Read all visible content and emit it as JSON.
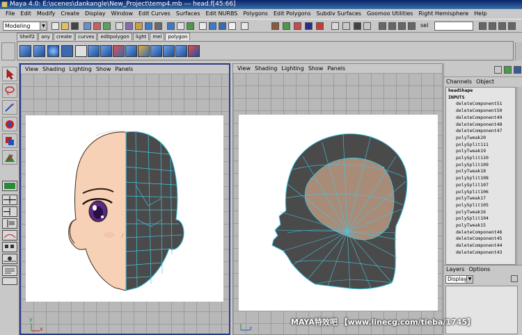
{
  "window": {
    "title": "Maya 4.0: E:\\scenes\\dankangle\\New_Project\\temp4.mb   ---   head.f[45:66]"
  },
  "menubar": [
    "File",
    "Edit",
    "Modify",
    "Create",
    "Display",
    "Window",
    "Edit Curves",
    "Surfaces",
    "Edit NURBS",
    "Polygons",
    "Edit Polygons",
    "Subdiv Surfaces",
    "Goomoo Utilities",
    "Right Hemisphere",
    "Help"
  ],
  "statusline": {
    "mode": "Modeling",
    "sel_label": "sel"
  },
  "shelf_tabs": [
    "Shelf2",
    "any",
    "create",
    "curves",
    "editpolygon",
    "light",
    "mel",
    "polygon"
  ],
  "viewport_left": {
    "menu": [
      "View",
      "Shading",
      "Lighting",
      "Show",
      "Panels"
    ]
  },
  "viewport_right": {
    "menu": [
      "View",
      "Shading",
      "Lighting",
      "Show",
      "Panels"
    ]
  },
  "axis_labels": {
    "x": "x",
    "y": "y",
    "z": "z"
  },
  "channel_box": {
    "menu": [
      "Channels",
      "Object"
    ],
    "shape": "headShape",
    "inputs_label": "INPUTS",
    "items": [
      "deleteComponent51",
      "deleteComponent50",
      "deleteComponent49",
      "deleteComponent48",
      "deleteComponent47",
      "polyTweak20",
      "polySplit111",
      "polyTweak19",
      "polySplit110",
      "polySplit109",
      "polyTweak18",
      "polySplit108",
      "polySplit107",
      "polySplit106",
      "polyTweak17",
      "polySplit105",
      "polyTweak16",
      "polySplit104",
      "polyTweak15",
      "deleteComponent46",
      "deleteComponent45",
      "deleteComponent44",
      "deleteComponent43"
    ]
  },
  "layer_editor": {
    "menu": [
      "Layers",
      "Options"
    ],
    "display": "Display"
  },
  "watermark": "MAYA特效吧 【www.linecg.com/tieba/1745】",
  "colors": {
    "mesh_wire": "#40c8e6",
    "mesh_dark": "#4a4a4a",
    "skin": "#f7d1b5",
    "selected_faces": "#a88c78",
    "active_border": "#2b3a86"
  }
}
